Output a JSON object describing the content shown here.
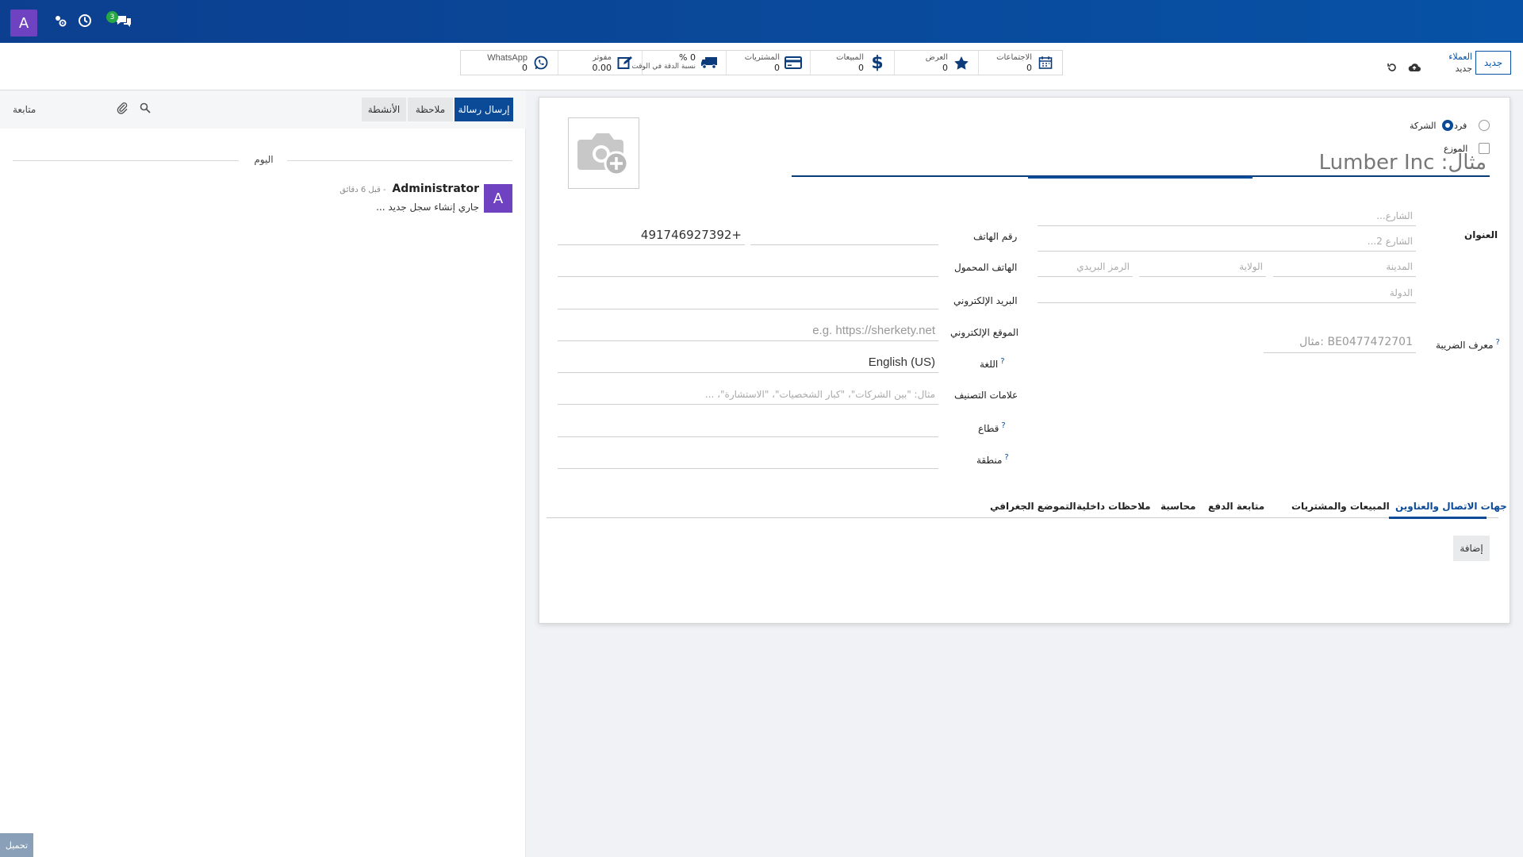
{
  "topbar": {
    "avatar_letter": "A",
    "chat_badge": "3",
    "colors": {
      "background": "#0b4a96",
      "avatar": "#6f42c1",
      "badge": "#28a745"
    },
    "icons": [
      "user-settings-icon",
      "clock-icon",
      "chat-icon"
    ]
  },
  "control": {
    "new_button": "جديد",
    "breadcrumb": {
      "parent": "العملاء",
      "current": "جديد"
    },
    "icons": [
      "cloud-save-icon",
      "discard-icon"
    ]
  },
  "stats": [
    {
      "label": "الاجتماعات",
      "value": "0",
      "icon": "calendar-icon"
    },
    {
      "label": "العرض",
      "value": "0",
      "icon": "star-icon"
    },
    {
      "label": "المبيعات",
      "value": "0",
      "icon": "dollar-icon"
    },
    {
      "label": "المشتريات",
      "value": "0",
      "icon": "credit-card-icon"
    },
    {
      "label": "نسبة الدقة في الوقت",
      "value": "0 %",
      "icon": "truck-icon"
    },
    {
      "label": "مفوتر",
      "value": "0.00",
      "icon": "edit-icon"
    },
    {
      "label": "WhatsApp",
      "value": "0",
      "icon": "whatsapp-icon"
    }
  ],
  "chatter": {
    "send_message": "إرسال رسالة",
    "note": "ملاحظة",
    "activities": "الأنشطة",
    "follow": "متابعة",
    "today": "اليوم",
    "message": {
      "avatar_letter": "A",
      "author": "Administrator",
      "time": "- قبل 6 دقائق",
      "body": "جاري إنشاء سجل جديد ..."
    },
    "upload": "تحميل",
    "icons": [
      "search-icon",
      "paperclip-icon"
    ]
  },
  "form": {
    "type_individual": "فرد",
    "type_company": "الشركة",
    "selected_type": "company",
    "distributor_label": "الموزع",
    "name_placeholder": "مثال: Lumber Inc",
    "address_label": "العنوان",
    "street_ph": "الشارع...",
    "street2_ph": "الشارع 2...",
    "city_ph": "المدينة",
    "state_ph": "الولاية",
    "zip_ph": "الرمز البريدي",
    "country_ph": "الدولة",
    "vat_label": "معرف الضريبة",
    "vat_ph": "مثال: BE0477472701",
    "phone_label": "رقم الهاتف",
    "phone_value": "491746927392+",
    "mobile_label": "الهاتف المحمول",
    "email_label": "البريد الإلكتروني",
    "website_label": "الموقع الإلكتروني",
    "website_ph": "e.g. https://sherkety.net",
    "language_label": "اللغة",
    "language_value": "English (US)",
    "tags_label": "علامات التصنيف",
    "tags_ph": "مثال: \"بين الشركات\"، \"كبار الشخصيات\"، \"الاستشارة\"، ...",
    "sector_label": "قطاع",
    "region_label": "منطقة",
    "help_mark": "?"
  },
  "tabs": [
    "جهات الاتصال والعناوين",
    "المبيعات والمشتريات",
    "متابعة الدفع",
    "محاسبة",
    "ملاحظات داخلية",
    "التموضع الجغرافي"
  ],
  "add_button": "إضافة"
}
